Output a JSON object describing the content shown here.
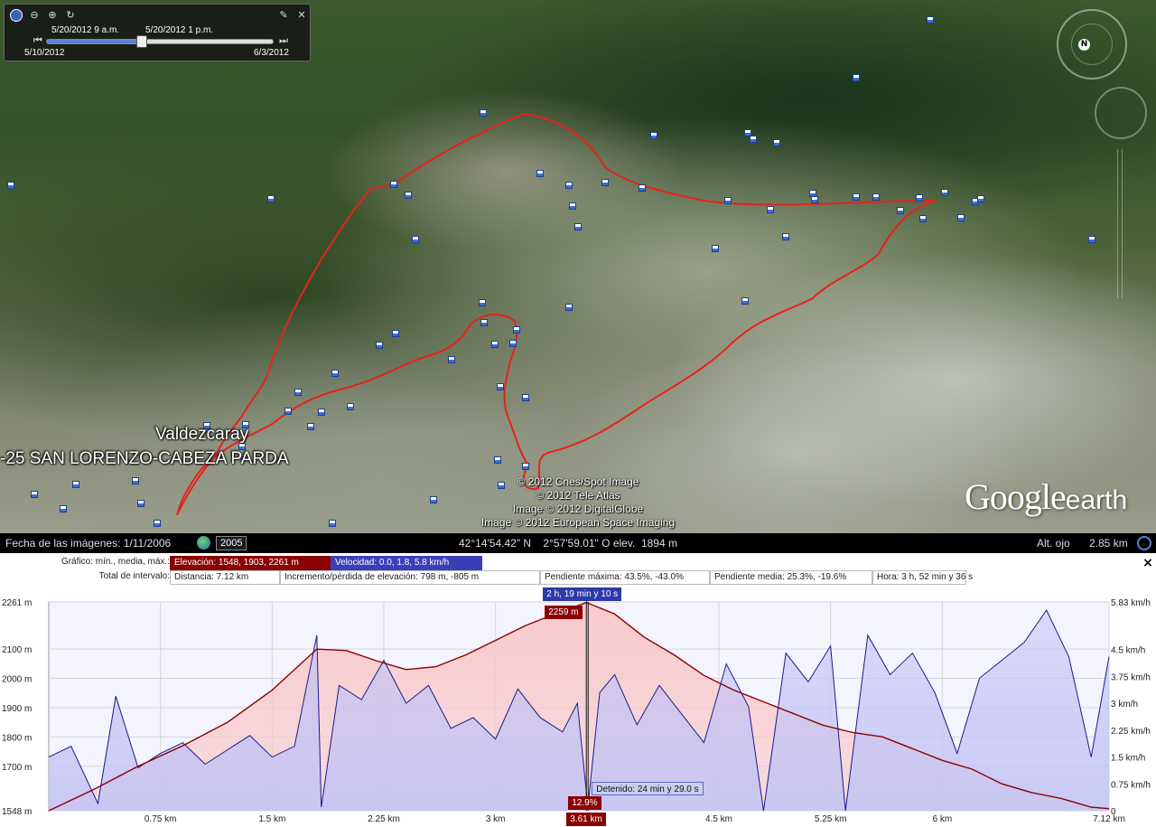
{
  "time_slider": {
    "start_label": "5/20/2012   9 a.m.",
    "end_label": "5/20/2012   1 p.m.",
    "range_start": "5/10/2012",
    "range_end": "6/3/2012",
    "position_fraction": 0.42
  },
  "map": {
    "place_label": "Valdezcaray",
    "route_label": "-25 SAN LORENZO-CABEZA PARDA",
    "attributions": [
      "© 2012 Cnes/Spot Image",
      "© 2012 Tele Atlas",
      "Image © 2012 DigitalGlobe",
      "Image © 2012 European Space Imaging"
    ],
    "logo_google": "Google",
    "logo_earth": "earth",
    "north_label": "N",
    "track_color": "#e8211e"
  },
  "status_bar": {
    "imagery_date": "Fecha de las imágenes: 1/11/2006",
    "year": "2005",
    "coordinates": "42°14'54.42\" N    2°57'59.01\" O elev.  1894 m",
    "eye_label": "Alt. ojo",
    "eye_value": "2.85 km"
  },
  "profile": {
    "graph_label": "Gráfico: mín., media, máx.:",
    "elevation_stat": "Elevación: 1548, 1903, 2261 m",
    "speed_stat": "Velocidad: 0.0, 1.8, 5.8 km/h",
    "total_label": "Total de intervalo:",
    "distance": "Distancia: 7.12 km",
    "elevation_gain": "Incremento/pérdida de elevación: 798 m, -805 m",
    "max_slope": "Pendiente máxima: 43.5%, -43.0%",
    "avg_slope": "Pendiente media: 25.3%, -19.6%",
    "duration": "Hora: 3 h, 52 min y 36 s",
    "close_label": "×",
    "colors": {
      "elevation": "#8b0000",
      "speed": "#1a1a8a",
      "elev_fill": "#f8c8c8",
      "speed_fill": "#c4c4f4"
    }
  },
  "chart_data": {
    "type": "line",
    "x_unit": "km",
    "xlim": [
      0,
      7.12
    ],
    "x_ticks": [
      {
        "value": 0.75,
        "label": "0.75 km"
      },
      {
        "value": 1.5,
        "label": "1.5 km"
      },
      {
        "value": 2.25,
        "label": "2.25 km"
      },
      {
        "value": 3.0,
        "label": "3 km"
      },
      {
        "value": 4.5,
        "label": "4.5 km"
      },
      {
        "value": 5.25,
        "label": "5.25 km"
      },
      {
        "value": 6.0,
        "label": "6 km"
      },
      {
        "value": 7.12,
        "label": "7.12 km"
      }
    ],
    "y_left": {
      "unit": "m",
      "range": [
        1548,
        2261
      ],
      "ticks": [
        {
          "value": 2261,
          "label": "2261 m"
        },
        {
          "value": 2100,
          "label": "2100 m"
        },
        {
          "value": 2000,
          "label": "2000 m"
        },
        {
          "value": 1900,
          "label": "1900 m"
        },
        {
          "value": 1800,
          "label": "1800 m"
        },
        {
          "value": 1700,
          "label": "1700 m"
        },
        {
          "value": 1548,
          "label": "1548 m"
        }
      ]
    },
    "y_right": {
      "unit": "km/h",
      "range": [
        0,
        5.83
      ],
      "ticks": [
        {
          "value": 5.83,
          "label": "5.83 km/h"
        },
        {
          "value": 4.5,
          "label": "4.5 km/h"
        },
        {
          "value": 3.75,
          "label": "3.75 km/h"
        },
        {
          "value": 3.0,
          "label": "3 km/h"
        },
        {
          "value": 2.25,
          "label": "2.25 km/h"
        },
        {
          "value": 1.5,
          "label": "1.5 km/h"
        },
        {
          "value": 0.75,
          "label": "0.75 km/h"
        },
        {
          "value": 0,
          "label": "0"
        }
      ]
    },
    "series": [
      {
        "name": "Elevación",
        "x": [
          0,
          0.3,
          0.6,
          0.9,
          1.2,
          1.5,
          1.8,
          2.0,
          2.2,
          2.4,
          2.6,
          2.8,
          3.0,
          3.2,
          3.4,
          3.61,
          3.8,
          4.0,
          4.2,
          4.4,
          4.6,
          4.8,
          5.0,
          5.2,
          5.4,
          5.6,
          5.8,
          6.0,
          6.2,
          6.4,
          6.6,
          6.8,
          7.0,
          7.12
        ],
        "values": [
          1548,
          1620,
          1700,
          1770,
          1850,
          1960,
          2100,
          2095,
          2060,
          2030,
          2040,
          2080,
          2130,
          2180,
          2220,
          2259,
          2220,
          2140,
          2080,
          2010,
          1960,
          1920,
          1880,
          1840,
          1815,
          1800,
          1760,
          1720,
          1690,
          1640,
          1610,
          1590,
          1560,
          1555
        ]
      },
      {
        "name": "Velocidad",
        "x": [
          0,
          0.15,
          0.33,
          0.45,
          0.6,
          0.75,
          0.9,
          1.05,
          1.2,
          1.35,
          1.5,
          1.65,
          1.8,
          1.83,
          1.95,
          2.1,
          2.25,
          2.4,
          2.55,
          2.7,
          2.85,
          3.0,
          3.15,
          3.3,
          3.45,
          3.55,
          3.62,
          3.7,
          3.8,
          3.95,
          4.1,
          4.25,
          4.4,
          4.55,
          4.7,
          4.8,
          4.95,
          5.1,
          5.25,
          5.35,
          5.5,
          5.65,
          5.8,
          5.95,
          6.1,
          6.25,
          6.4,
          6.55,
          6.7,
          6.85,
          7.0,
          7.12
        ],
        "values": [
          1.5,
          1.8,
          0.2,
          3.2,
          1.2,
          1.6,
          1.9,
          1.3,
          1.7,
          2.1,
          1.5,
          1.8,
          4.9,
          0.1,
          3.5,
          3.1,
          4.2,
          3.0,
          3.5,
          2.3,
          2.6,
          2.0,
          3.4,
          2.6,
          2.2,
          3.0,
          0.1,
          3.3,
          3.8,
          2.4,
          3.5,
          2.7,
          1.9,
          4.1,
          2.9,
          0.0,
          4.4,
          3.6,
          4.6,
          0.0,
          4.9,
          3.8,
          4.4,
          3.3,
          1.6,
          3.7,
          4.2,
          4.7,
          5.6,
          4.3,
          1.5,
          4.3
        ]
      }
    ],
    "cursor": {
      "x": 3.61,
      "x_label": "3.61 km",
      "time_label": "2 h, 19 min y 10 s",
      "elevation_label": "2259 m",
      "slope_label": "12.9%",
      "stopped_label": "Detenido: 24 min y 29.0 s"
    }
  }
}
